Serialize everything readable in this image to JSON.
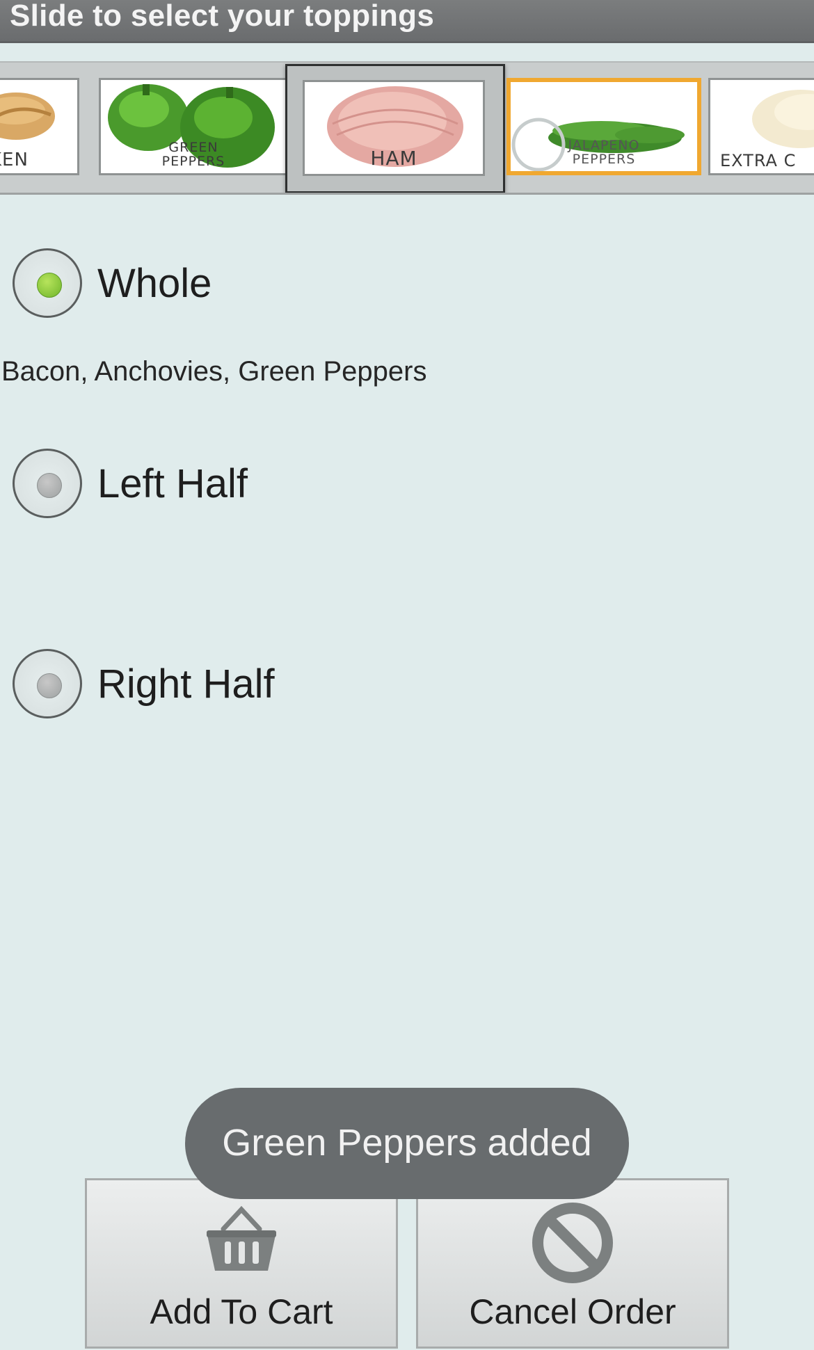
{
  "header": {
    "title": "Slide to select your toppings"
  },
  "toppings": [
    {
      "id": "chicken",
      "label": "KEN",
      "icon": "bread-icon"
    },
    {
      "id": "green-peppers",
      "label_line1": "GREEN",
      "label_line2": "PEPPERS",
      "icon": "green-pepper-icon"
    },
    {
      "id": "ham",
      "label": "HAM",
      "icon": "ham-icon",
      "selected": true
    },
    {
      "id": "jalapeno-peppers",
      "label_line1": "JALAPENO",
      "label_line2": "PEPPERS",
      "icon": "jalapeno-icon",
      "focused": true
    },
    {
      "id": "extra-cheese",
      "label": "EXTRA C",
      "icon": "cheese-icon"
    }
  ],
  "placement": {
    "options": [
      {
        "id": "whole",
        "label": "Whole",
        "checked": true
      },
      {
        "id": "left-half",
        "label": "Left Half",
        "checked": false
      },
      {
        "id": "right-half",
        "label": "Right Half",
        "checked": false
      }
    ],
    "summary": "Bacon, Anchovies, Green Peppers"
  },
  "toast": {
    "message": "Green Peppers added"
  },
  "actions": {
    "add_to_cart": "Add To Cart",
    "cancel_order": "Cancel Order"
  },
  "colors": {
    "background": "#e0ecec",
    "title_bar": "#737577",
    "focus_border": "#f0a830",
    "radio_checked": "#8ccf3a",
    "toast": "#686c6e"
  }
}
